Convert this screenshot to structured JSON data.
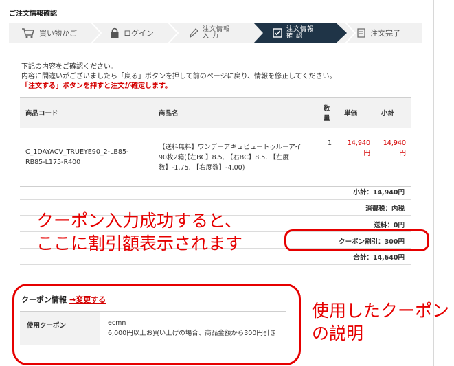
{
  "page_title": "ご注文情報確認",
  "steps": [
    {
      "label": "買い物かご",
      "icon": "cart-icon"
    },
    {
      "label": "ログイン",
      "icon": "lock-icon"
    },
    {
      "label_line1": "注文情報",
      "label_line2": "入 力",
      "icon": "pencil-icon"
    },
    {
      "label_line1": "注文情報",
      "label_line2": "確 認",
      "icon": "check-box-icon",
      "active": true
    },
    {
      "label": "注文完了",
      "icon": "document-icon"
    }
  ],
  "intro": {
    "line1": "下記の内容をご確認ください。",
    "line2": "内容に間違いがございましたら「戻る」ボタンを押して前のページに戻り、情報を修正してください。",
    "warning": "「注文する」ボタンを押すと注文が確定します。"
  },
  "table": {
    "headers": {
      "code": "商品コード",
      "name": "商品名",
      "qty_line1": "数",
      "qty_line2": "量",
      "price": "単価",
      "subtotal": "小計"
    },
    "rows": [
      {
        "code_line1": "C_1DAYACV_TRUEYE90_2-LB85-",
        "code_line2": "RB85-L175-R400",
        "name_line1": "【送料無料】ワンデーアキュビュートゥルーアイ",
        "name_line2": "90枚2箱(【左BC】8.5, 【右BC】8.5, 【左度",
        "name_line3": "数】-1.75, 【右度数】-4.00)",
        "qty": "1",
        "price_line1": "14,940",
        "price_line2": "円",
        "subtotal_line1": "14,940",
        "subtotal_line2": "円"
      }
    ]
  },
  "summary": {
    "subtotal": "小計：14,940円",
    "tax": "消費税：内税",
    "shipping": "送料：0円",
    "coupon": "クーポン割引：300円",
    "total": "合計：14,640円"
  },
  "annotations": {
    "coupon_success_line1": "クーポン入力成功すると、",
    "coupon_success_line2": "ここに割引額表示されます",
    "coupon_desc_line1": "使用したクーポン",
    "coupon_desc_line2": "の説明"
  },
  "coupon": {
    "title": "クーポン情報",
    "change_link": "→変更する",
    "label": "使用クーポン",
    "code": "ecmn",
    "description": "6,000円以上お買い上げの場合、商品金額から300円引き"
  },
  "colors": {
    "accent_red": "#d40000",
    "annotation_red": "#e60000",
    "step_active": "#1f3447",
    "step_bg": "#f1f1f1"
  }
}
